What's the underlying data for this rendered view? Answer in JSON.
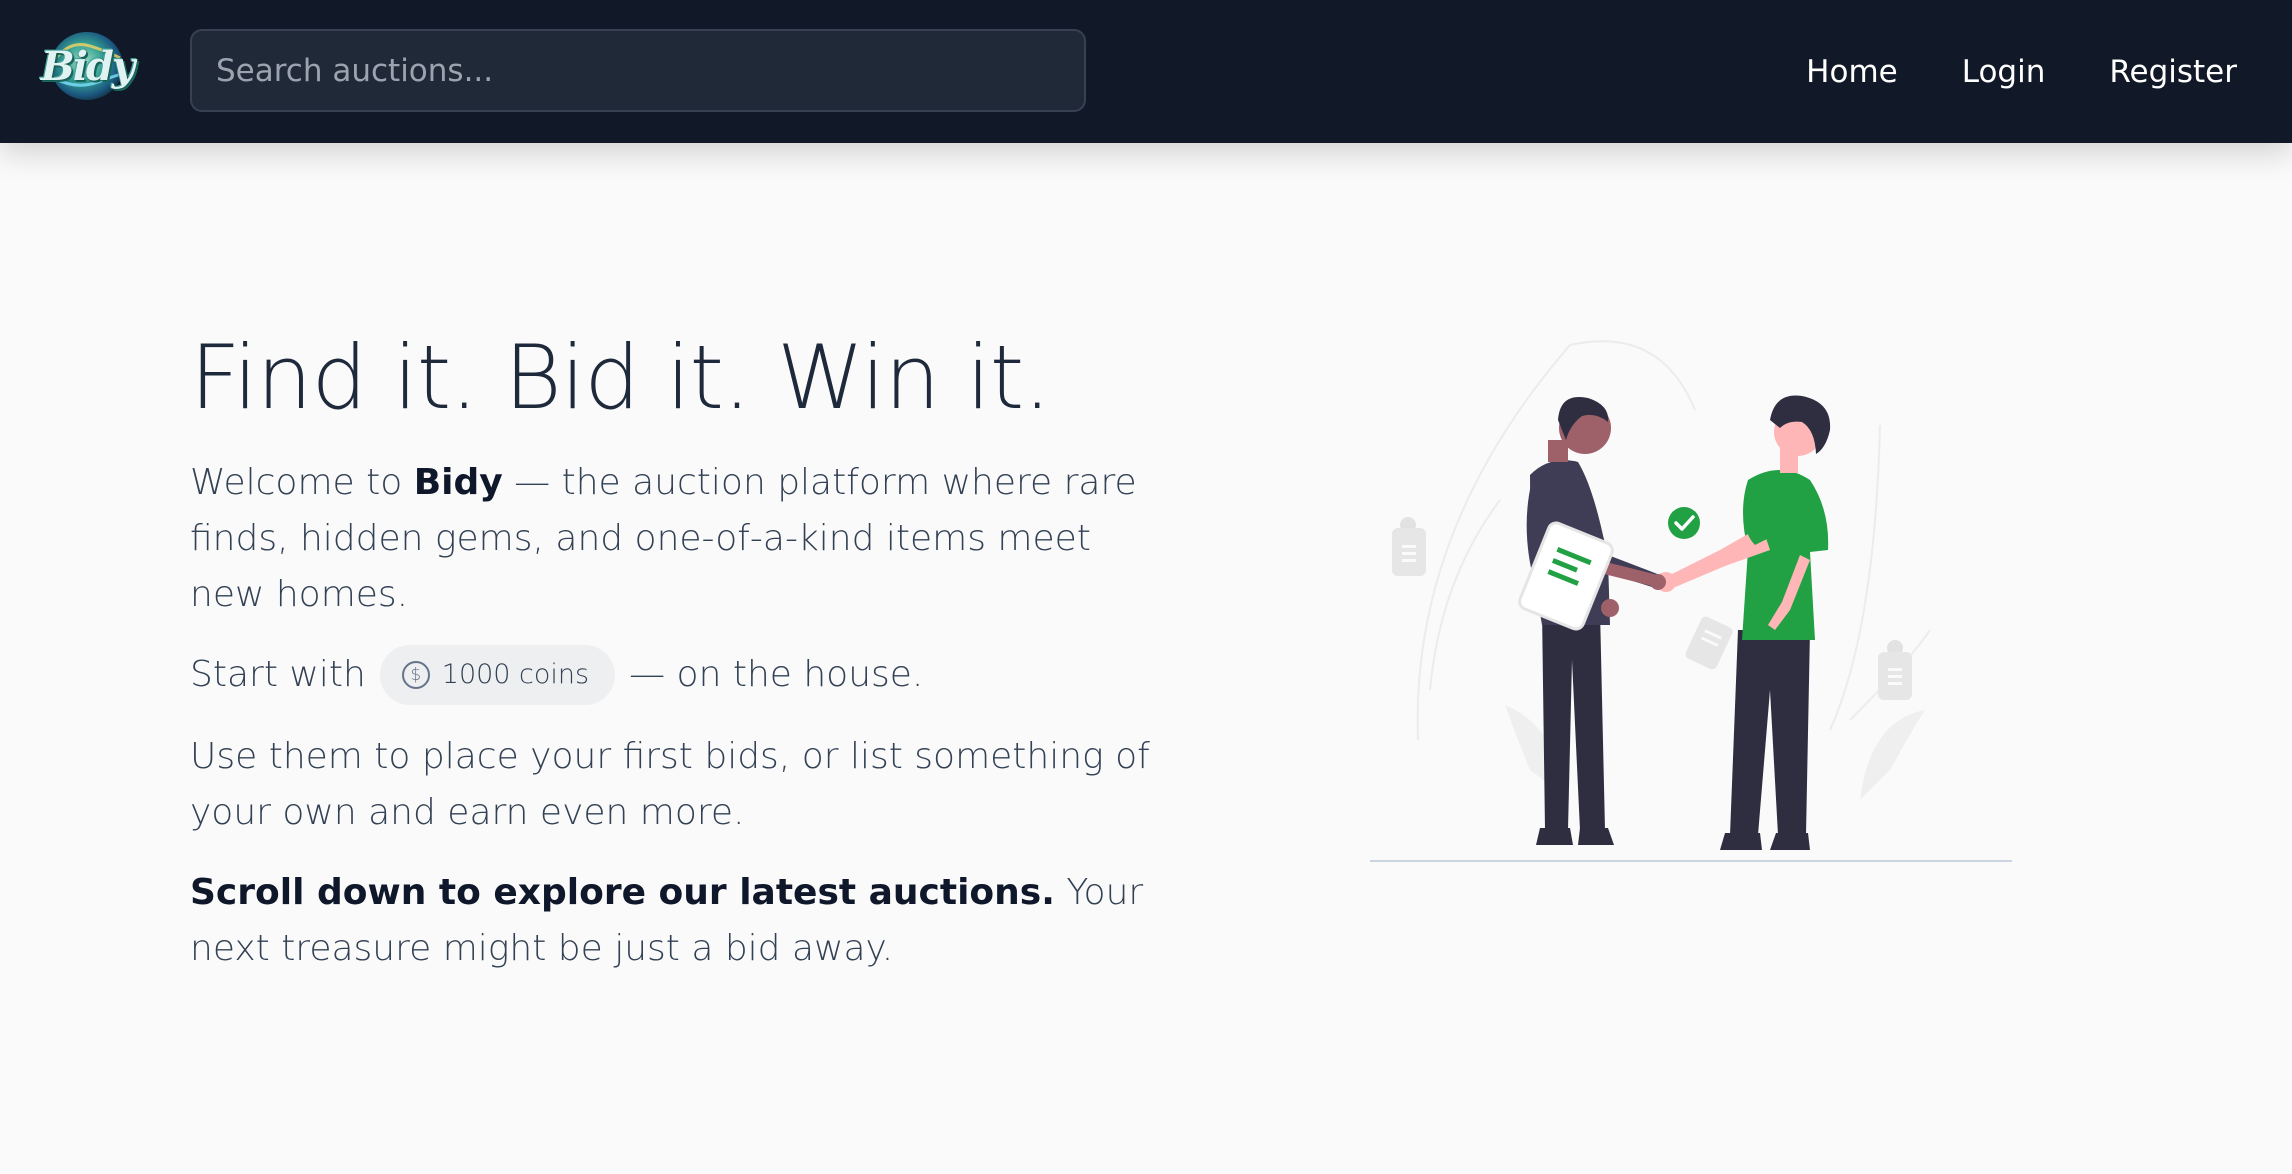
{
  "navbar": {
    "logo_text": "Bidy",
    "search_placeholder": "Search auctions...",
    "links": {
      "home": "Home",
      "login": "Login",
      "register": "Register"
    }
  },
  "hero": {
    "title": "Find it. Bid it. Win it.",
    "intro_prefix": "Welcome to ",
    "brand": "Bidy",
    "intro_suffix": " — the auction platform where rare finds, hidden gems, and one-of-a-kind items meet new homes.",
    "start_prefix": "Start with",
    "coin_symbol": "$",
    "coins_label": "1000 coins",
    "start_suffix": "— on the house.",
    "use_text": "Use them to place your first bids, or list something of your own and earn even more.",
    "scroll_bold": "Scroll down to explore our latest auctions.",
    "scroll_rest": " Your next treasure might be just a bid away."
  },
  "colors": {
    "navbar_bg": "#111827",
    "page_bg": "#fafafa",
    "accent_green": "#22a144",
    "text_dark": "#1e293b"
  },
  "icons": {
    "coin": "coin-icon",
    "check": "check-icon"
  }
}
